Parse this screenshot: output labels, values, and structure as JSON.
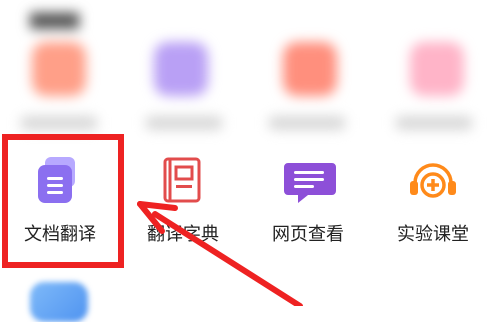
{
  "tools": [
    {
      "label": "文档翻译",
      "icon": "document-translate-icon"
    },
    {
      "label": "翻译字典",
      "icon": "dictionary-book-icon"
    },
    {
      "label": "网页查看",
      "icon": "webpage-chat-icon"
    },
    {
      "label": "实验课堂",
      "icon": "lab-classroom-icon"
    }
  ],
  "colors": {
    "highlight": "#ee2222",
    "doc_icon": "#8b6ff0",
    "book_icon": "#e24c4c",
    "chat_icon": "#8d4fd8",
    "lab_icon": "#ff8a1a"
  }
}
